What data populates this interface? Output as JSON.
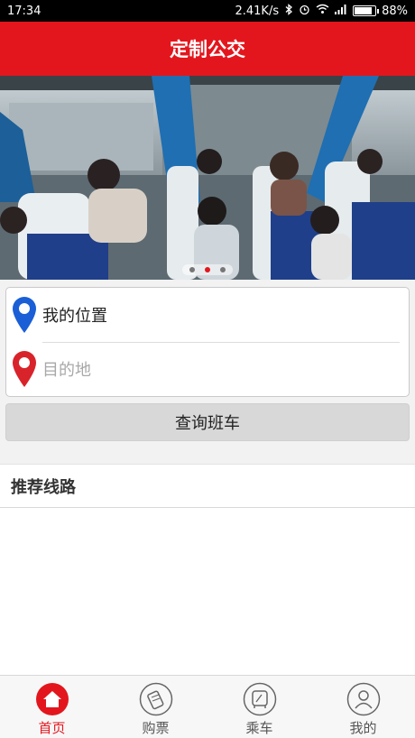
{
  "status_bar": {
    "time": "17:34",
    "network_speed": "2.41K/s",
    "battery_percent": "88%",
    "battery_level": 0.88
  },
  "header": {
    "title": "定制公交"
  },
  "banner": {
    "slide_count": 3,
    "active_slide": 2
  },
  "search": {
    "origin_value": "我的位置",
    "destination_placeholder": "目的地",
    "query_button_label": "查询班车"
  },
  "recommended": {
    "title": "推荐线路"
  },
  "tabbar": {
    "items": [
      {
        "label": "首页",
        "icon": "home-icon",
        "active": true
      },
      {
        "label": "购票",
        "icon": "ticket-icon",
        "active": false
      },
      {
        "label": "乘车",
        "icon": "bus-icon",
        "active": false
      },
      {
        "label": "我的",
        "icon": "user-icon",
        "active": false
      }
    ]
  },
  "colors": {
    "brand_red": "#e3161d",
    "pin_blue": "#1a5fd6",
    "pin_red": "#d9232a"
  }
}
